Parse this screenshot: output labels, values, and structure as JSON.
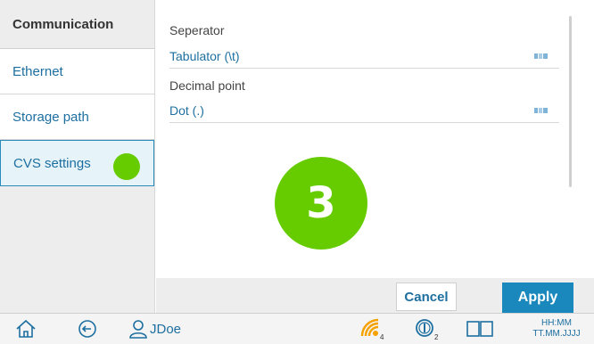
{
  "sidebar": {
    "header": "Communication",
    "items": [
      {
        "label": "Ethernet"
      },
      {
        "label": "Storage path"
      },
      {
        "label": "CVS settings"
      }
    ]
  },
  "main": {
    "separator_label": "Seperator",
    "separator_value": "Tabulator (\\t)",
    "decimal_label": "Decimal point",
    "decimal_value": "Dot (.)",
    "step_number": "3"
  },
  "buttons": {
    "cancel": "Cancel",
    "apply": "Apply"
  },
  "statusbar": {
    "user": "JDoe",
    "signal_sub": "4",
    "info_sub": "2",
    "time": "HH:MM",
    "date": "TT.MM.JJJJ"
  },
  "colors": {
    "accent": "#1a87bd",
    "link": "#1d6fa0",
    "highlight_green": "#66cc00",
    "signal_orange": "#f5a100"
  }
}
